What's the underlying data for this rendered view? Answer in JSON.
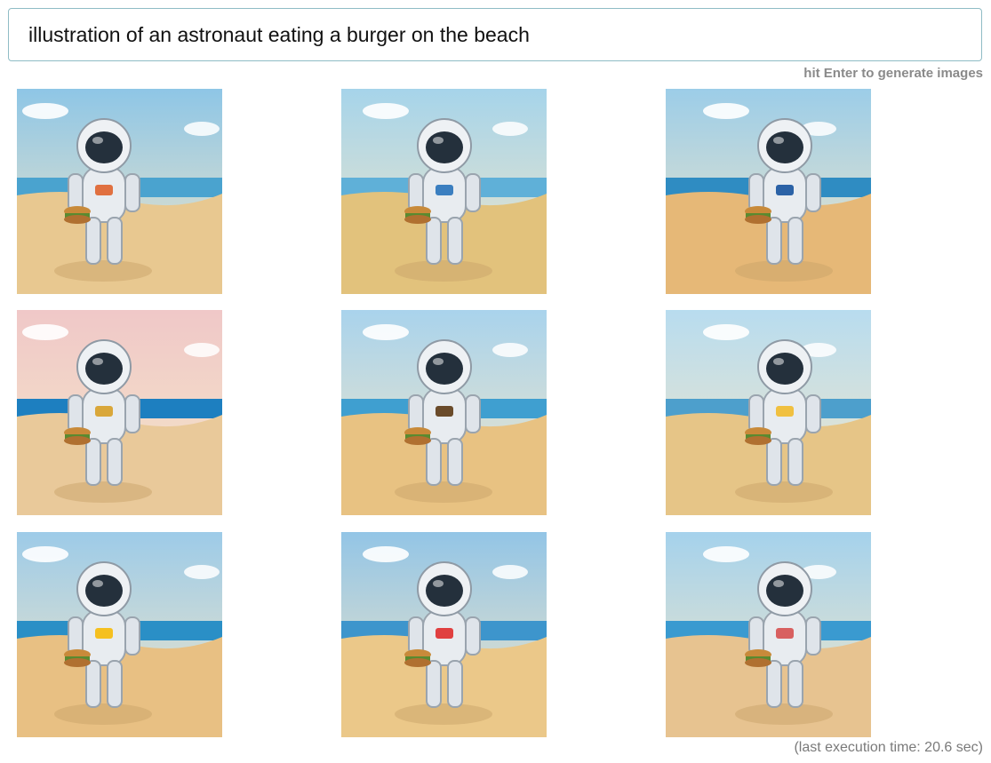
{
  "prompt": {
    "value": "illustration of an astronaut eating a burger on the beach",
    "hint": "hit Enter to generate images"
  },
  "images": [
    {
      "id": "image-1",
      "palette": {
        "sky": "#8ec6e6",
        "sand": "#e8c890",
        "sea": "#4aa3cf",
        "accent": "#e07040"
      }
    },
    {
      "id": "image-2",
      "palette": {
        "sky": "#a6d4ea",
        "sand": "#e2c27c",
        "sea": "#5fb0d8",
        "accent": "#3b7fc0"
      }
    },
    {
      "id": "image-3",
      "palette": {
        "sky": "#9ccde8",
        "sand": "#e6b877",
        "sea": "#2f8cc2",
        "accent": "#2b62a6"
      }
    },
    {
      "id": "image-4",
      "palette": {
        "sky": "#f0c8c8",
        "sand": "#e9c99a",
        "sea": "#1d7fc0",
        "accent": "#d9a73a"
      }
    },
    {
      "id": "image-5",
      "palette": {
        "sky": "#a9d3ec",
        "sand": "#e8c282",
        "sea": "#3f9fd0",
        "accent": "#6a4b2a"
      }
    },
    {
      "id": "image-6",
      "palette": {
        "sky": "#b8dcef",
        "sand": "#e6c587",
        "sea": "#4d9fcc",
        "accent": "#f0c040"
      }
    },
    {
      "id": "image-7",
      "palette": {
        "sky": "#9dcbe8",
        "sand": "#e8c083",
        "sea": "#2a8fc6",
        "accent": "#f5c020"
      }
    },
    {
      "id": "image-8",
      "palette": {
        "sky": "#93c5e6",
        "sand": "#ebc889",
        "sea": "#3d95cc",
        "accent": "#e04040"
      }
    },
    {
      "id": "image-9",
      "palette": {
        "sky": "#a5d2ec",
        "sand": "#e7c390",
        "sea": "#3a9ad0",
        "accent": "#d86060"
      }
    }
  ],
  "footer": {
    "execution_time": "(last execution time: 20.6 sec)"
  }
}
